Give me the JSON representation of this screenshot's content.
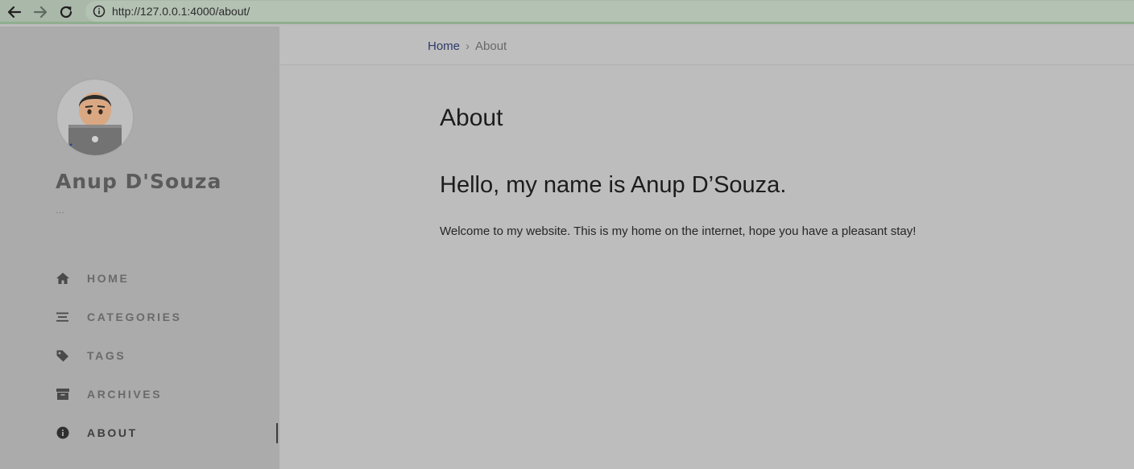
{
  "browser": {
    "url": "http://127.0.0.1:4000/about/",
    "icons": {
      "back": "arrow-left-icon",
      "forward": "arrow-right-icon",
      "reload": "reload-icon",
      "info": "info-circle-icon"
    }
  },
  "sidebar": {
    "avatar_icon": "technologist-emoji-icon",
    "title": "Anup D'Souza",
    "subtitle": "...",
    "nav": [
      {
        "label": "HOME",
        "icon": "home-icon"
      },
      {
        "label": "CATEGORIES",
        "icon": "stream-icon"
      },
      {
        "label": "TAGS",
        "icon": "tag-icon"
      },
      {
        "label": "ARCHIVES",
        "icon": "archive-icon"
      },
      {
        "label": "ABOUT",
        "icon": "info-circle-icon",
        "active": true
      }
    ]
  },
  "breadcrumb": {
    "home": "Home",
    "separator": "›",
    "current": "About"
  },
  "main": {
    "title": "About",
    "heading": "Hello, my name is Anup D’Souza.",
    "body": "Welcome to my website. This is my home on the internet, hope you have a pleasant stay!"
  },
  "colors": {
    "sidebar_bg": "#ababab",
    "content_bg": "#bdbdbd",
    "link": "#2e3a6b"
  }
}
